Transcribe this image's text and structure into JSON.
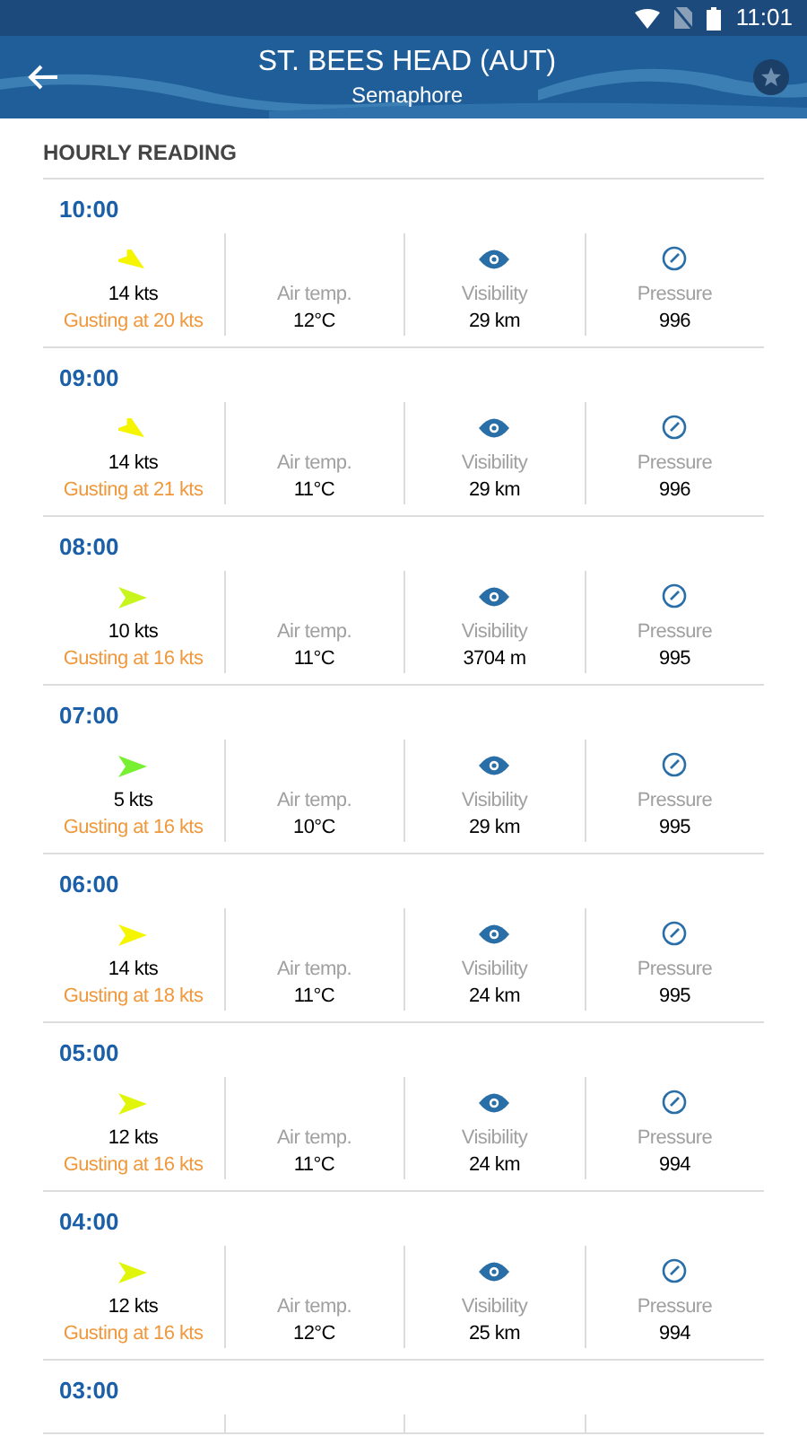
{
  "status_bar": {
    "time": "11:01"
  },
  "header": {
    "title": "ST. BEES HEAD (AUT)",
    "subtitle": "Semaphore"
  },
  "section_title": "HOURLY READING",
  "readings": [
    {
      "time": "10:00",
      "wind": {
        "speed": "14 kts",
        "gust": "Gusting at 20 kts",
        "color": "#f5f500",
        "kind": "diagonal"
      },
      "air_temp": {
        "label": "Air temp.",
        "value": "12°C"
      },
      "visibility": {
        "label": "Visibility",
        "value": "29 km"
      },
      "pressure": {
        "label": "Pressure",
        "value": "996"
      }
    },
    {
      "time": "09:00",
      "wind": {
        "speed": "14 kts",
        "gust": "Gusting at 21 kts",
        "color": "#f5f500",
        "kind": "diagonal"
      },
      "air_temp": {
        "label": "Air temp.",
        "value": "11°C"
      },
      "visibility": {
        "label": "Visibility",
        "value": "29 km"
      },
      "pressure": {
        "label": "Pressure",
        "value": "996"
      }
    },
    {
      "time": "08:00",
      "wind": {
        "speed": "10 kts",
        "gust": "Gusting at 16 kts",
        "color": "#c8f51e",
        "kind": "straight"
      },
      "air_temp": {
        "label": "Air temp.",
        "value": "11°C"
      },
      "visibility": {
        "label": "Visibility",
        "value": "3704 m"
      },
      "pressure": {
        "label": "Pressure",
        "value": "995"
      }
    },
    {
      "time": "07:00",
      "wind": {
        "speed": "5 kts",
        "gust": "Gusting at 16 kts",
        "color": "#78f032",
        "kind": "straight"
      },
      "air_temp": {
        "label": "Air temp.",
        "value": "10°C"
      },
      "visibility": {
        "label": "Visibility",
        "value": "29 km"
      },
      "pressure": {
        "label": "Pressure",
        "value": "995"
      }
    },
    {
      "time": "06:00",
      "wind": {
        "speed": "14 kts",
        "gust": "Gusting at 18 kts",
        "color": "#f5f500",
        "kind": "straight"
      },
      "air_temp": {
        "label": "Air temp.",
        "value": "11°C"
      },
      "visibility": {
        "label": "Visibility",
        "value": "24 km"
      },
      "pressure": {
        "label": "Pressure",
        "value": "995"
      }
    },
    {
      "time": "05:00",
      "wind": {
        "speed": "12 kts",
        "gust": "Gusting at 16 kts",
        "color": "#e1f50a",
        "kind": "straight"
      },
      "air_temp": {
        "label": "Air temp.",
        "value": "11°C"
      },
      "visibility": {
        "label": "Visibility",
        "value": "24 km"
      },
      "pressure": {
        "label": "Pressure",
        "value": "994"
      }
    },
    {
      "time": "04:00",
      "wind": {
        "speed": "12 kts",
        "gust": "Gusting at 16 kts",
        "color": "#e1f50a",
        "kind": "straight"
      },
      "air_temp": {
        "label": "Air temp.",
        "value": "12°C"
      },
      "visibility": {
        "label": "Visibility",
        "value": "25 km"
      },
      "pressure": {
        "label": "Pressure",
        "value": "994"
      }
    },
    {
      "time": "03:00"
    }
  ]
}
